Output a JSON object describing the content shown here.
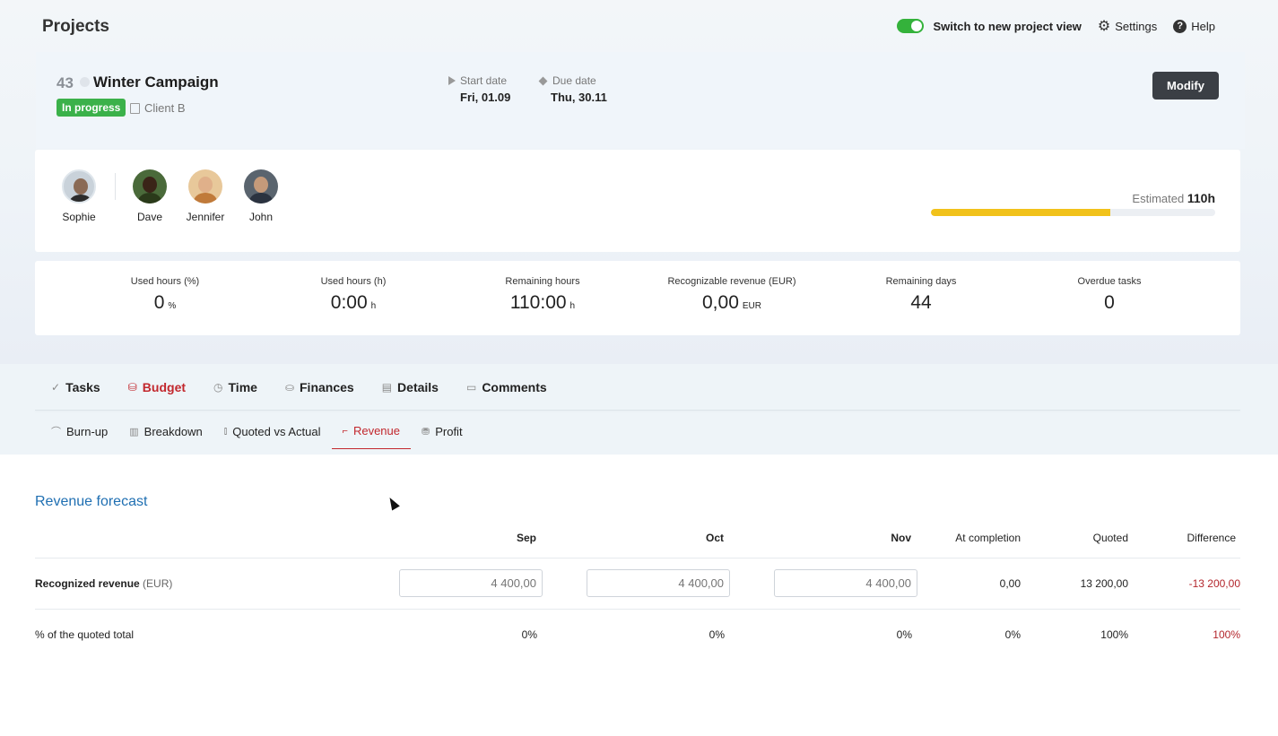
{
  "header": {
    "title": "Projects",
    "switch_label": "Switch to new project view",
    "settings_label": "Settings",
    "help_label": "Help"
  },
  "project": {
    "id": "43",
    "name": "Winter Campaign",
    "status": "In progress",
    "client": "Client B",
    "start_label": "Start date",
    "start_value": "Fri, 01.09",
    "due_label": "Due date",
    "due_value": "Thu, 30.11",
    "modify_label": "Modify"
  },
  "team": {
    "members": [
      "Sophie",
      "Dave",
      "Jennifer",
      "John"
    ],
    "estimated_label": "Estimated",
    "estimated_value": "110h",
    "progress_fraction": 0.63
  },
  "kpis": [
    {
      "label": "Used hours (%)",
      "value": "0",
      "unit": "%"
    },
    {
      "label": "Used hours (h)",
      "value": "0:00",
      "unit": "h"
    },
    {
      "label": "Remaining hours",
      "value": "110:00",
      "unit": "h"
    },
    {
      "label": "Recognizable revenue (EUR)",
      "value": "0,00",
      "unit": "EUR"
    },
    {
      "label": "Remaining days",
      "value": "44",
      "unit": ""
    },
    {
      "label": "Overdue tasks",
      "value": "0",
      "unit": ""
    }
  ],
  "main_tabs": [
    "Tasks",
    "Budget",
    "Time",
    "Finances",
    "Details",
    "Comments"
  ],
  "sub_tabs": [
    "Burn-up",
    "Breakdown",
    "Quoted vs Actual",
    "Revenue",
    "Profit"
  ],
  "revenue": {
    "title": "Revenue forecast",
    "columns": [
      "Sep",
      "Oct",
      "Nov",
      "At completion",
      "Quoted",
      "Difference"
    ],
    "row1_label": "Recognized revenue",
    "row1_unit": "(EUR)",
    "row1_inputs": [
      "4 400,00",
      "4 400,00",
      "4 400,00"
    ],
    "row1_at_completion": "0,00",
    "row1_quoted": "13 200,00",
    "row1_difference": "-13 200,00",
    "row2_label": "% of the quoted total",
    "row2_values": [
      "0%",
      "0%",
      "0%",
      "0%",
      "100%",
      "100%"
    ]
  },
  "colors": {
    "accent_red": "#c2272d",
    "status_green": "#3bb14a",
    "progress_yellow": "#f1c21b",
    "link_blue": "#1f6fb2"
  }
}
